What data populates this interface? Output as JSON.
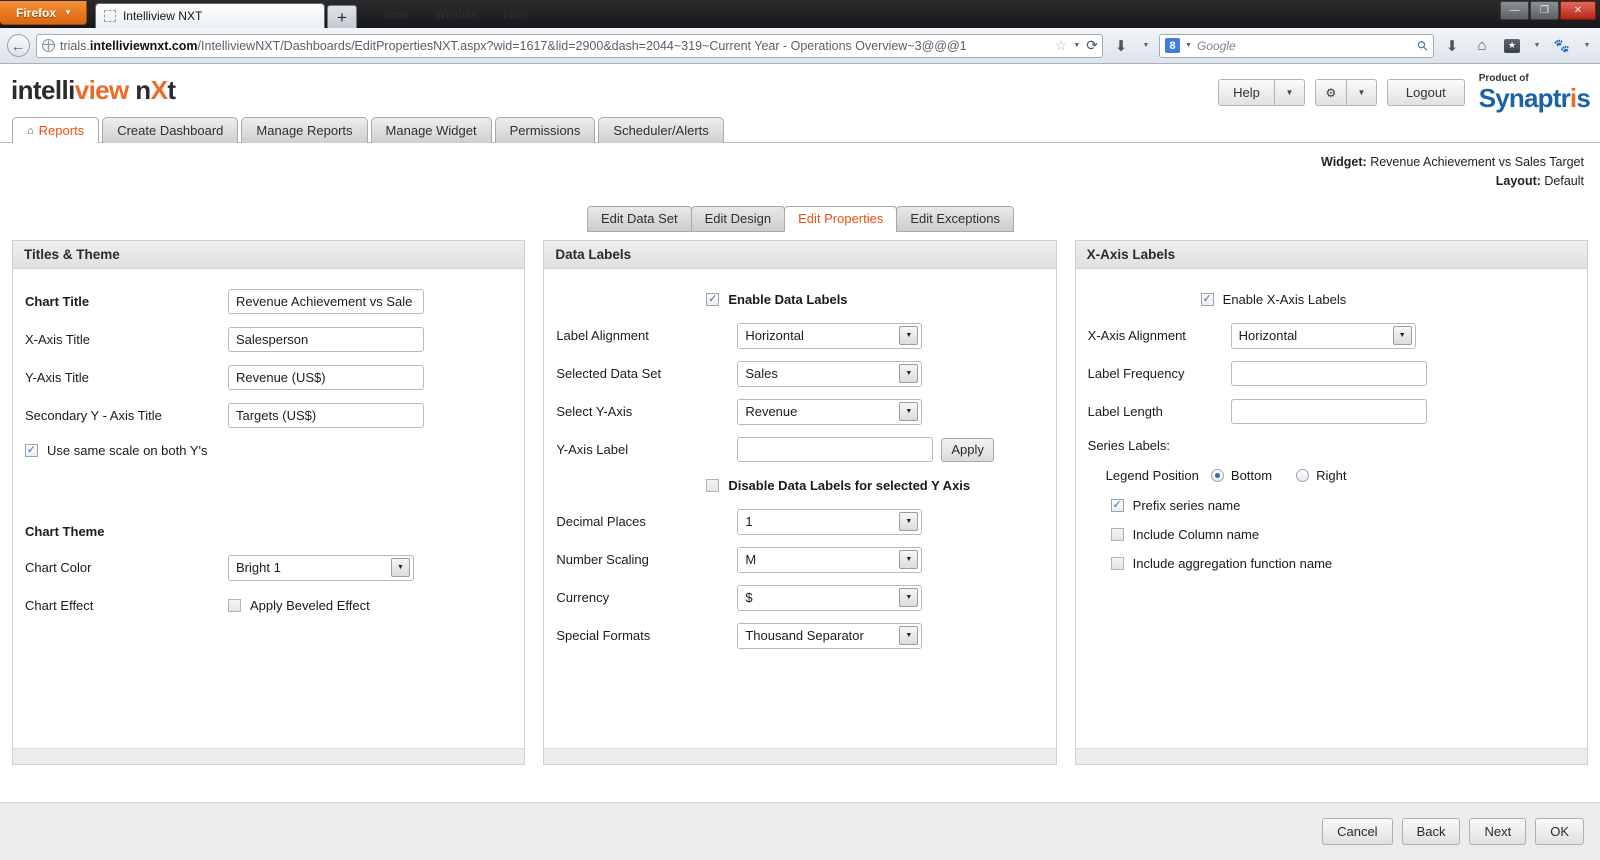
{
  "browser": {
    "firefox_button": "Firefox",
    "tab_title": "Intelliview NXT",
    "new_tab_label": "+",
    "ghost_menu": [
      "View",
      "Window",
      "Help"
    ],
    "url_prefix": "trials.",
    "url_domain": "intelliviewnxt.com",
    "url_path": "/IntelliviewNXT/Dashboards/EditPropertiesNXT.aspx?wid=1617&lid=2900&dash=2044~319~Current Year - Operations Overview~3@@@1",
    "search_placeholder": "Google",
    "search_engine_letter": "8",
    "window_minimize": "—",
    "window_restore": "❐",
    "window_close": "✕"
  },
  "app": {
    "logo": {
      "part1": "intelli",
      "part2": "view",
      "part3": "n",
      "part4": "X",
      "part5": "t"
    },
    "help_label": "Help",
    "logout_label": "Logout",
    "brand": {
      "product_of": "Product of",
      "name_a": "Synaptr",
      "name_i": "i",
      "name_b": "s"
    },
    "main_tabs": [
      {
        "label": "Reports",
        "active": true,
        "icon": "home-icon"
      },
      {
        "label": "Create Dashboard",
        "active": false
      },
      {
        "label": "Manage Reports",
        "active": false
      },
      {
        "label": "Manage Widget",
        "active": false
      },
      {
        "label": "Permissions",
        "active": false
      },
      {
        "label": "Scheduler/Alerts",
        "active": false
      }
    ],
    "widget_info": {
      "widget_label": "Widget:",
      "widget_value": "Revenue Achievement vs Sales Target",
      "layout_label": "Layout:",
      "layout_value": "Default"
    },
    "sub_tabs": [
      {
        "label": "Edit Data Set",
        "active": false
      },
      {
        "label": "Edit Design",
        "active": false
      },
      {
        "label": "Edit Properties",
        "active": true
      },
      {
        "label": "Edit Exceptions",
        "active": false
      }
    ]
  },
  "titles_theme": {
    "panel_title": "Titles & Theme",
    "chart_title_label": "Chart Title",
    "chart_title_value": "Revenue Achievement vs Sale",
    "x_axis_title_label": "X-Axis Title",
    "x_axis_title_value": "Salesperson",
    "y_axis_title_label": "Y-Axis Title",
    "y_axis_title_value": "Revenue (US$)",
    "secondary_y_label": "Secondary Y - Axis Title",
    "secondary_y_value": "Targets (US$)",
    "same_scale_label": "Use same scale on both Y's",
    "same_scale_checked": true,
    "chart_theme_heading": "Chart Theme",
    "chart_color_label": "Chart Color",
    "chart_color_value": "Bright 1",
    "chart_effect_label": "Chart Effect",
    "beveled_label": "Apply Beveled Effect",
    "beveled_checked": false
  },
  "data_labels": {
    "panel_title": "Data Labels",
    "enable_label": "Enable Data Labels",
    "enable_checked": true,
    "label_alignment_label": "Label Alignment",
    "label_alignment_value": "Horizontal",
    "selected_data_set_label": "Selected Data Set",
    "selected_data_set_value": "Sales",
    "select_y_axis_label": "Select Y-Axis",
    "select_y_axis_value": "Revenue",
    "y_axis_label_label": "Y-Axis Label",
    "y_axis_label_value": "",
    "apply_label": "Apply",
    "disable_label": "Disable Data Labels for selected Y Axis",
    "disable_checked": false,
    "decimal_places_label": "Decimal Places",
    "decimal_places_value": "1",
    "number_scaling_label": "Number Scaling",
    "number_scaling_value": "M",
    "currency_label": "Currency",
    "currency_value": "$",
    "special_formats_label": "Special Formats",
    "special_formats_value": "Thousand Separator"
  },
  "x_axis_labels": {
    "panel_title": "X-Axis Labels",
    "enable_label": "Enable X-Axis Labels",
    "enable_checked": true,
    "alignment_label": "X-Axis Alignment",
    "alignment_value": "Horizontal",
    "label_frequency_label": "Label Frequency",
    "label_frequency_value": "",
    "label_length_label": "Label Length",
    "label_length_value": "",
    "series_labels_heading": "Series  Labels:",
    "legend_position_label": "Legend Position",
    "legend_bottom_label": "Bottom",
    "legend_right_label": "Right",
    "legend_selected": "Bottom",
    "prefix_series_label": "Prefix series name",
    "prefix_series_checked": true,
    "include_column_label": "Include Column name",
    "include_column_checked": false,
    "include_aggregation_label": "Include aggregation function name",
    "include_aggregation_checked": false
  },
  "footer": {
    "cancel": "Cancel",
    "back": "Back",
    "next": "Next",
    "ok": "OK"
  },
  "colors": {
    "accent_orange": "#ef4e16",
    "brand_blue": "#1b63a6"
  }
}
